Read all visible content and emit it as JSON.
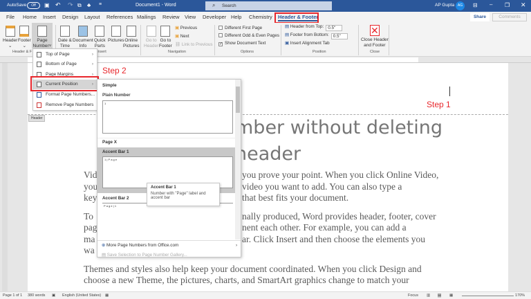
{
  "titlebar": {
    "autosave": "AutoSave",
    "autosave_state": "Off",
    "title": "Document1 - Word",
    "search_placeholder": "Search",
    "user": "AP Gupta",
    "avatar": "AG"
  },
  "tabs": [
    "File",
    "Home",
    "Insert",
    "Design",
    "Layout",
    "References",
    "Mailings",
    "Review",
    "View",
    "Developer",
    "Help",
    "Chemistry",
    "Header & Footer"
  ],
  "active_tab": "Header & Footer",
  "share": "Share",
  "comments": "Comments",
  "ribbon": {
    "hf": {
      "header": "Header",
      "footer": "Footer",
      "page_number_1": "Page",
      "page_number_2": "Number",
      "group": "Header & F"
    },
    "insert": {
      "date1": "Date &",
      "date2": "Time",
      "doc1": "Document",
      "doc2": "Info",
      "qp1": "Quick",
      "qp2": "Parts",
      "pictures": "Pictures",
      "op1": "Online",
      "op2": "Pictures",
      "group": "Insert"
    },
    "nav": {
      "gh1": "Go to",
      "gh2": "Header",
      "gf1": "Go to",
      "gf2": "Footer",
      "previous": "Previous",
      "next": "Next",
      "link": "Link to Previous",
      "group": "Navigation"
    },
    "options": {
      "first": "Different First Page",
      "oddeven": "Different Odd & Even Pages",
      "showdoc": "Show Document Text",
      "group": "Options"
    },
    "position": {
      "hft": "Header from Top:",
      "hft_val": "0.5\"",
      "ffb": "Footer from Bottom:",
      "ffb_val": "0.5\"",
      "align": "Insert Alignment Tab",
      "group": "Position"
    },
    "close": {
      "l1": "Close Header",
      "l2": "and Footer",
      "group": "Close"
    }
  },
  "menu": [
    "Top of Page",
    "Bottom of Page",
    "Page Margins",
    "Current Position",
    "Format Page Numbers...",
    "Remove Page Numbers"
  ],
  "gallery": {
    "simple": "Simple",
    "plain": "Plain Number",
    "plain_preview": "1",
    "pagex": "Page X",
    "ab1": "Accent Bar 1",
    "ab1_preview": "1 | P a g e",
    "ab2": "Accent Bar 2",
    "ab2_preview": "P a g e | 1",
    "more": "More Page Numbers from Office.com",
    "save": "Save Selection to Page Number Gallery..."
  },
  "tooltip": {
    "title": "Accent Bar 1",
    "desc": "Number with \"Page\" label and accent bar"
  },
  "annotations": {
    "step1": "Step 1",
    "step2": "Step 2",
    "accent": "#e8262b"
  },
  "header_tag": "Header",
  "doc": {
    "heading1": "mber without deleting",
    "heading2": "header",
    "lines": [
      [
        "Vid",
        "you prove your point. When you click Online Video,"
      ],
      [
        "you",
        "video you want to add. You can also type a"
      ],
      [
        "key",
        "that best fits your document."
      ],
      [
        "To",
        "nally produced, Word provides header, footer, cover"
      ],
      [
        "pag",
        "nent each other. For example, you can add a"
      ],
      [
        "ma",
        "ar. Click Insert and then choose the elements you"
      ],
      [
        "wa",
        ""
      ]
    ],
    "para3": [
      "Themes and styles also help keep your document coordinated. When you click Design and",
      "choose a new Theme, the pictures, charts, and SmartArt graphics change to match your"
    ]
  },
  "status": {
    "page": "Page 1 of 1",
    "words": "380 words",
    "lang": "English (United States)",
    "focus": "Focus",
    "zoom": "170%"
  }
}
